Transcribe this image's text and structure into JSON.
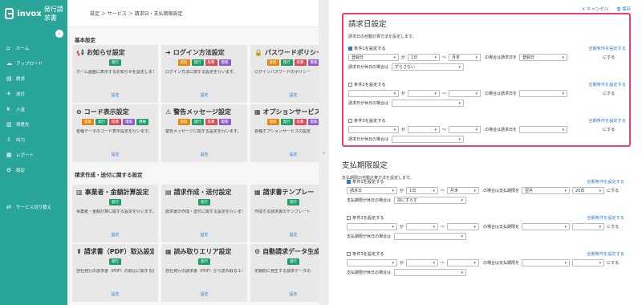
{
  "app": {
    "brand": "invox",
    "subtitle": "発行請求書"
  },
  "breadcrumb": "設定 ＞ サービス ＞ 請求日・支払期限設定",
  "sidebar": {
    "items": [
      {
        "label": "ホーム",
        "icon": "home-icon",
        "glyph": "⌂"
      },
      {
        "label": "アップロード",
        "icon": "upload-icon",
        "glyph": "☁"
      },
      {
        "label": "請求",
        "icon": "invoice-icon",
        "glyph": "▤"
      },
      {
        "label": "送付",
        "icon": "send-icon",
        "glyph": "✈"
      },
      {
        "label": "入金",
        "icon": "payment-icon",
        "glyph": "¥"
      },
      {
        "label": "得意先",
        "icon": "clients-icon",
        "glyph": "▥"
      },
      {
        "label": "出力",
        "icon": "output-icon",
        "glyph": "⇩"
      },
      {
        "label": "レポート",
        "icon": "report-icon",
        "glyph": "▦"
      },
      {
        "label": "設定",
        "icon": "settings-icon",
        "glyph": "⚙"
      },
      {
        "label": "サービス切り替え",
        "icon": "switch-icon",
        "glyph": "⇄"
      }
    ]
  },
  "left": {
    "section1": "基本設定",
    "section2": "請求作成・送付に関する設定",
    "cards": [
      {
        "title": "お知らせ設定",
        "glyph": "📢",
        "badges": [
          [
            "発行",
            "g"
          ]
        ],
        "desc": "ホーム画面に表示するお知らせを設定します。",
        "link": "設定"
      },
      {
        "title": "ログイン方法設定",
        "glyph": "➜",
        "badges": [
          [
            "受取",
            "o"
          ],
          [
            "発行",
            "g"
          ],
          [
            "経費",
            "r"
          ],
          [
            "電帳",
            "p"
          ]
        ],
        "desc": "ログイン方法に関する設定を行います。",
        "link": "設定"
      },
      {
        "title": "パスワードポリシー",
        "glyph": "🔒",
        "badges": [
          [
            "受取",
            "o"
          ],
          [
            "発行",
            "g"
          ],
          [
            "経費",
            "r"
          ],
          [
            "電帳",
            "p"
          ]
        ],
        "desc": "ログインパスワードのポリシー",
        "link": "設定"
      },
      {
        "title": "コード表示設定",
        "glyph": "⊖",
        "badges": [
          [
            "受取",
            "o"
          ],
          [
            "発行",
            "g"
          ],
          [
            "経費",
            "r"
          ],
          [
            "電帳",
            "p"
          ],
          [
            "債権",
            "g"
          ]
        ],
        "desc": "各種データのコード表示設定を行います。",
        "link": "設定"
      },
      {
        "title": "警告メッセージ設定",
        "glyph": "⚠",
        "badges": [
          [
            "受取",
            "o"
          ],
          [
            "発行",
            "g"
          ],
          [
            "経費",
            "r"
          ],
          [
            "電帳",
            "p"
          ]
        ],
        "desc": "警告メッセージに関する設定を行います。",
        "link": "設定"
      },
      {
        "title": "オプションサービス",
        "glyph": "▦",
        "badges": [
          [
            "受取",
            "o"
          ],
          [
            "発行",
            "g"
          ],
          [
            "経費",
            "r"
          ],
          [
            "電帳",
            "p"
          ]
        ],
        "desc": "各種オプションサービスの設定",
        "link": "設定"
      },
      {
        "title": "事業者・金額計算設定",
        "glyph": "▥",
        "badges": [
          [
            "発行",
            "g"
          ]
        ],
        "desc": "事業者・金額計算に関する設定を行います。",
        "link": "設定"
      },
      {
        "title": "請求作成・送付設定",
        "glyph": "▤",
        "badges": [
          [
            "発行",
            "g"
          ]
        ],
        "desc": "請求書の作成・送付に関する設定を行います。",
        "link": "設定"
      },
      {
        "title": "請求書テンプレー",
        "glyph": "▦",
        "badges": [
          [
            "発行",
            "g"
          ]
        ],
        "desc": "作成する請求書のテンプレート",
        "link": "設定"
      },
      {
        "title": "請求書（PDF）取込設定",
        "glyph": "⬆",
        "badges": [
          [
            "発行",
            "g"
          ]
        ],
        "desc": "自社発行の請求書（PDF）の取込に関する設定を行います。",
        "link": "設定"
      },
      {
        "title": "読み取りエリア設定",
        "glyph": "▦",
        "badges": [
          [
            "発行",
            "g"
          ]
        ],
        "desc": "自社発行の請求書（PDF）から読み取るエリアを設定します。",
        "link": "設定"
      },
      {
        "title": "自動請求データ生成",
        "glyph": "⚙",
        "badges": [
          [
            "発行",
            "g"
          ]
        ],
        "desc": "定期的に発生する請求データの",
        "link": "設定"
      }
    ]
  },
  "header": {
    "cancel": "✕ キャンセル",
    "save": "🖫 保存"
  },
  "billing": {
    "title": "請求日設定",
    "desc": "請求日の自動計算方法を設定します。",
    "conds": [
      {
        "label": "条件1を設定する",
        "checked": true,
        "link": "全期条件を設定する",
        "a": "登録日",
        "b": "1日",
        "c": "月末",
        "d": "登録日",
        "holiday": "ずらさない"
      },
      {
        "label": "条件2を設定する",
        "checked": false,
        "link": "全期条件を設定する",
        "a": "",
        "b": "",
        "c": "",
        "d": "",
        "holiday": ""
      },
      {
        "label": "条件3を設定する",
        "checked": false,
        "link": "全期条件を設定する",
        "a": "",
        "b": "",
        "c": "",
        "d": "",
        "holiday": ""
      }
    ],
    "ga": "が",
    "tilde": "〜",
    "mid": "の場合は請求日を",
    "end": "にする",
    "hol": "請求日が休日の場合は"
  },
  "payment": {
    "title": "支払期限設定",
    "desc": "支払期限の自動計算方法を設定します。",
    "conds": [
      {
        "label": "条件1を設定する",
        "checked": true,
        "link": "全期条件を設定する",
        "a": "請求日",
        "b": "1日",
        "c": "月末",
        "d": "翌月",
        "e": "20日",
        "holiday": "前にずらす"
      },
      {
        "label": "条件2を設定する",
        "checked": false,
        "link": "全期条件を設定する",
        "a": "",
        "b": "",
        "c": "",
        "d": "",
        "e": "",
        "holiday": ""
      },
      {
        "label": "条件3を設定する",
        "checked": false,
        "link": "全期条件を設定する",
        "a": "",
        "b": "",
        "c": "",
        "d": "",
        "e": "",
        "holiday": ""
      }
    ],
    "ga": "が",
    "tilde": "〜",
    "mid": "の場合は支払期限を",
    "end": "にする",
    "hol": "支払期限が休日の場合は"
  }
}
